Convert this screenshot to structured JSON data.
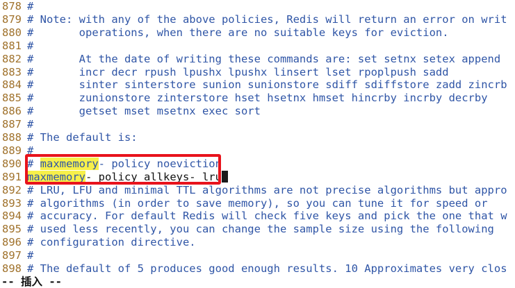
{
  "editor": {
    "lines": [
      {
        "num": "878",
        "text": "#"
      },
      {
        "num": "879",
        "text": "# Note: with any of the above policies, Redis will return an error on writ"
      },
      {
        "num": "880",
        "text": "#       operations, when there are no suitable keys for eviction."
      },
      {
        "num": "881",
        "text": "#"
      },
      {
        "num": "882",
        "text": "#       At the date of writing these commands are: set setnx setex append"
      },
      {
        "num": "883",
        "text": "#       incr decr rpush lpushx lpushx linsert lset rpoplpush sadd"
      },
      {
        "num": "884",
        "text": "#       sinter sinterstore sunion sunionstore sdiff sdiffstore zadd zincrb"
      },
      {
        "num": "885",
        "text": "#       zunionstore zinterstore hset hsetnx hmset hincrby incrby decrby"
      },
      {
        "num": "886",
        "text": "#       getset mset msetnx exec sort"
      },
      {
        "num": "887",
        "text": "#"
      },
      {
        "num": "888",
        "text": "# The default is:"
      },
      {
        "num": "889",
        "text": "#"
      },
      {
        "num": "890",
        "prefix": "# ",
        "highlight": "maxmemory",
        "rest": "- policy noeviction"
      },
      {
        "num": "891",
        "highlight": "maxmemory",
        "rest": "- policy allkeys- lru"
      },
      {
        "num": "892",
        "text": "# LRU, LFU and minimal TTL algorithms are not precise algorithms but appro"
      },
      {
        "num": "893",
        "text": "# algorithms (in order to save memory), so you can tune it for speed or"
      },
      {
        "num": "894",
        "text": "# accuracy. For default Redis will check five keys and pick the one that w"
      },
      {
        "num": "895",
        "text": "# used less recently, you can change the sample size using the following"
      },
      {
        "num": "896",
        "text": "# configuration directive."
      },
      {
        "num": "897",
        "text": "#"
      },
      {
        "num": "898",
        "text": "# The default of 5 produces good enough results. 10 Approximates very clos"
      }
    ]
  },
  "status": {
    "mode": "-- 插入 --"
  },
  "colors": {
    "line_number": "#a0722c",
    "comment": "#2f55a6",
    "search_highlight": "#f7f04a",
    "annotation_box": "#e8131c"
  }
}
